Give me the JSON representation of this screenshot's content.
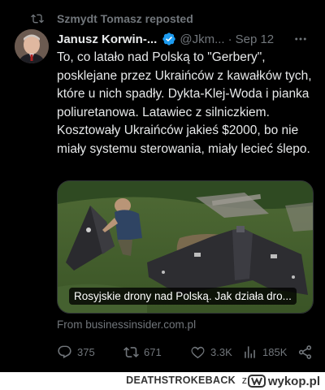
{
  "repost": {
    "text": "Szmydt Tomasz reposted",
    "icon": "repost-icon"
  },
  "author": {
    "name": "Janusz Korwin-...",
    "handle": "@Jkm...",
    "separator": "·",
    "date": "Sep 12",
    "verified_color": "#1d9bf0"
  },
  "tweet": {
    "text": "To, co latało nad Polską to \"Gerbery\", posklejane przez Ukraińców z kawałków tych, które u nich spadły. Dykta-Klej-Woda i pianka poliuretanowa. Latawiec z silniczkiem. Kosztowały Ukraińców jakieś $2000, bo nie miały systemu sterowania, miały lecieć ślepo."
  },
  "media": {
    "caption": "Rosyjskie drony nad Polską. Jak działa dro...",
    "source": "From businessinsider.com.pl"
  },
  "actions": {
    "replies": "375",
    "reposts": "671",
    "likes": "3.3K",
    "views": "185K"
  },
  "footer": {
    "username": "DEATHSTROKEBACK",
    "connector": "z",
    "site": "wykop.pl"
  },
  "colors": {
    "background": "#000000",
    "text": "#e7e9ea",
    "muted": "#71767b",
    "accent": "#1d9bf0"
  }
}
